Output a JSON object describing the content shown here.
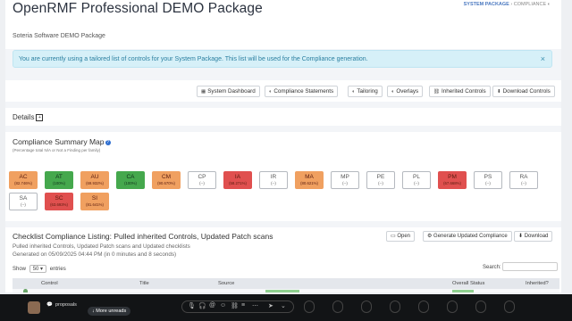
{
  "header": {
    "title": "OpenRMF Professional DEMO Package",
    "subtitle": "Soteria Software DEMO Package",
    "breadcrumb": [
      "SYSTEM PACKAGE",
      "COMPLIANCE"
    ]
  },
  "alert": {
    "text": "You are currently using a tailored list of controls for your System Package. This list will be used for the Compliance generation.",
    "close": "×"
  },
  "toolbar": [
    {
      "label": "System Dashboard",
      "icon": "grid-icon"
    },
    {
      "label": "Compliance Statements",
      "icon": "half-circle-icon"
    },
    {
      "label": "Tailoring",
      "icon": "half-circle-icon"
    },
    {
      "label": "Overlays",
      "icon": "half-circle-icon"
    },
    {
      "label": "Inherited Controls",
      "icon": "link-icon"
    },
    {
      "label": "Download Controls",
      "icon": "download-icon"
    }
  ],
  "details": {
    "label": "Details",
    "toggle": "+"
  },
  "map": {
    "title": "Compliance Summary Map",
    "help": "?",
    "subtitle": "(Percentage total N/A or Not a Finding per family)",
    "colors": {
      "orange": "#f0a060",
      "green": "#45a84d",
      "red": "#e0504f",
      "white": "#ffffff"
    },
    "families": [
      {
        "code": "AC",
        "pct": "(82.746%)",
        "status": "orange"
      },
      {
        "code": "AT",
        "pct": "(100%)",
        "status": "green"
      },
      {
        "code": "AU",
        "pct": "(69.932%)",
        "status": "orange"
      },
      {
        "code": "CA",
        "pct": "(100%)",
        "status": "green"
      },
      {
        "code": "CM",
        "pct": "(90.670%)",
        "status": "orange"
      },
      {
        "code": "CP",
        "pct": "(--)",
        "status": "white"
      },
      {
        "code": "IA",
        "pct": "(58.271%)",
        "status": "red"
      },
      {
        "code": "IR",
        "pct": "(--)",
        "status": "white"
      },
      {
        "code": "MA",
        "pct": "(80.621%)",
        "status": "orange"
      },
      {
        "code": "MP",
        "pct": "(--)",
        "status": "white"
      },
      {
        "code": "PE",
        "pct": "(--)",
        "status": "white"
      },
      {
        "code": "PL",
        "pct": "(--)",
        "status": "white"
      },
      {
        "code": "PM",
        "pct": "(67.668%)",
        "status": "red"
      },
      {
        "code": "PS",
        "pct": "(--)",
        "status": "white"
      },
      {
        "code": "RA",
        "pct": "(--)",
        "status": "white"
      },
      {
        "code": "SA",
        "pct": "(--)",
        "status": "white"
      },
      {
        "code": "SC",
        "pct": "(63.693%)",
        "status": "red"
      },
      {
        "code": "SI",
        "pct": "(81.641%)",
        "status": "orange"
      }
    ]
  },
  "listing": {
    "title": "Checklist Compliance Listing: Pulled inherited Controls, Updated Patch scans",
    "desc": "Pulled inherited Controls, Updated Patch scans and Updated checklists",
    "generated": "Generated on 05/09/2025 04:44 PM (in 0 minutes and 8 seconds)",
    "buttons": [
      "Open",
      "Generate Updated Compliance",
      "Download"
    ],
    "show_label": "Show",
    "show_value": "50",
    "entries_label": "entries",
    "search_label": "Search:",
    "columns": [
      "Control",
      "Title",
      "Source",
      "Overall Status",
      "Inherited?"
    ]
  },
  "taskbar": {
    "proposals": "proposals",
    "unread": "More unreads"
  }
}
